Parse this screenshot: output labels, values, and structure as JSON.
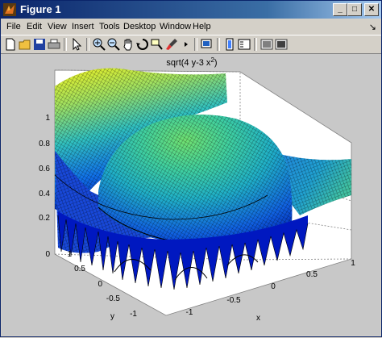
{
  "window": {
    "title": "Figure 1",
    "controls": {
      "minimize": "_",
      "maximize": "□",
      "close": "✕"
    }
  },
  "menu": [
    "File",
    "Edit",
    "View",
    "Insert",
    "Tools",
    "Desktop",
    "Window",
    "Help"
  ],
  "toolbar": {
    "icons": [
      "new-figure-icon",
      "open-file-icon",
      "save-icon",
      "print-icon",
      "edit-plot-arrow-icon",
      "zoom-in-icon",
      "zoom-out-icon",
      "pan-hand-icon",
      "rotate-3d-icon",
      "data-cursor-icon",
      "brush-icon",
      "link-plot-icon",
      "colorbar-icon",
      "legend-icon",
      "hide-plot-tools-icon",
      "show-plot-tools-icon"
    ],
    "dock_glyph": "↘"
  },
  "plot": {
    "title": "sqrt(4 y-3 x",
    "title_sup": "2",
    "title_close": ")",
    "xlabel": "x",
    "ylabel": "y",
    "z_ticks": [
      "0",
      "0.2",
      "0.4",
      "0.6",
      "0.8",
      "1"
    ],
    "x_ticks": [
      "-1",
      "-0.5",
      "0",
      "0.5",
      "1"
    ],
    "y_ticks": [
      "1",
      "0.5",
      "0",
      "-0.5",
      "-1"
    ],
    "colormap": "jet",
    "surface_colors": [
      "#f0f020",
      "#60e0a0",
      "#20b0c8",
      "#1060e8",
      "#0010a0"
    ],
    "grid": true
  }
}
